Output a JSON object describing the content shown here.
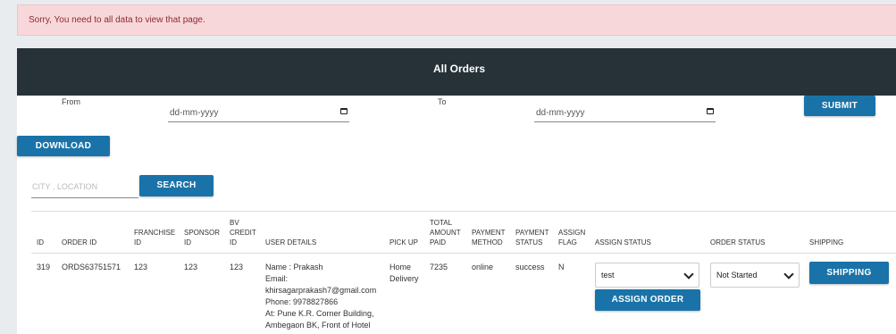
{
  "alert": {
    "message": "Sorry, You need to all data to view that page."
  },
  "panel": {
    "title": "All Orders"
  },
  "filters": {
    "from_label": "From",
    "from_placeholder": "dd-mm-yyyy",
    "to_label": "To",
    "to_placeholder": "dd-mm-yyyy",
    "submit_label": "SUBMIT",
    "download_label": "DOWNLOAD",
    "search_placeholder": "CITY , LOCATION",
    "search_label": "SEARCH"
  },
  "table": {
    "headers": {
      "id": "ID",
      "order_id": "ORDER ID",
      "franchise_id": "FRANCHISE ID",
      "sponsor_id": "SPONSOR ID",
      "bv_credit_id": "BV CREDIT ID",
      "user_details": "USER DETAILS",
      "pick_up": "PICK UP",
      "total_amount_paid": "TOTAL AMOUNT PAID",
      "payment_method": "PAYMENT METHOD",
      "payment_status": "PAYMENT STATUS",
      "assign_flag": "ASSIGN FLAG",
      "assign_status": "ASSIGN STATUS",
      "order_status": "ORDER STATUS",
      "shipping": "SHIPPING"
    },
    "rows": [
      {
        "id": "319",
        "order_id": "ORDS63751571",
        "franchise_id": "123",
        "sponsor_id": "123",
        "bv_credit_id": "123",
        "user_name": "Name : Prakash",
        "email_label": "Email:",
        "email": "khirsagarprakash7@gmail.com",
        "phone": "Phone: 9978827866",
        "address_1": "At: Pune K.R. Corner Building,",
        "address_2": "Ambegaon BK, Front of Hotel",
        "pick_up": "Home Delivery",
        "total_amount_paid": "7235",
        "payment_method": "online",
        "payment_status": "success",
        "assign_flag": "N",
        "assign_select_value": "test",
        "assign_button_label": "ASSIGN ORDER",
        "order_status_value": "Not Started",
        "shipping_label": "SHIPPING"
      }
    ]
  },
  "colors": {
    "header_bg": "#263238",
    "button_bg": "#1a73a8",
    "alert_bg": "#f8d7da",
    "alert_text": "#8a2c34"
  }
}
